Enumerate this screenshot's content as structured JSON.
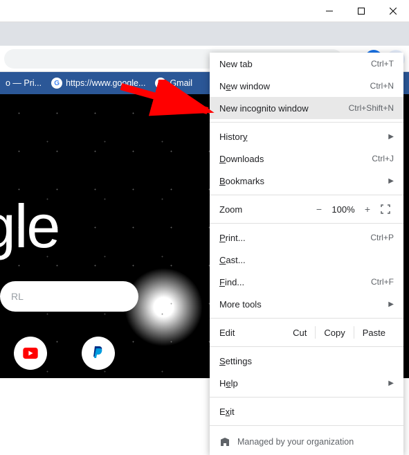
{
  "bookmarks": {
    "pri": "o — Pri...",
    "google": "https://www.google...",
    "gmail": "Gmail"
  },
  "content": {
    "logo": "oogle",
    "search_placeholder": "RL"
  },
  "menu": {
    "new_tab": {
      "label": "New tab",
      "shortcut": "Ctrl+T"
    },
    "new_window": {
      "label_pre": "N",
      "label_u": "e",
      "label_post": "w window",
      "shortcut": "Ctrl+N"
    },
    "new_incognito": {
      "label": "New incognito window",
      "shortcut": "Ctrl+Shift+N"
    },
    "history": {
      "label_pre": "Histor",
      "label_u": "y"
    },
    "downloads": {
      "label_u": "D",
      "label_post": "ownloads",
      "shortcut": "Ctrl+J"
    },
    "bookmarks": {
      "label_u": "B",
      "label_post": "ookmarks"
    },
    "zoom": {
      "label": "Zoom",
      "minus": "−",
      "value": "100%",
      "plus": "+"
    },
    "print": {
      "label_u": "P",
      "label_post": "rint...",
      "shortcut": "Ctrl+P"
    },
    "cast": {
      "label_u": "C",
      "label_post": "ast..."
    },
    "find": {
      "label_u": "F",
      "label_post": "ind...",
      "shortcut": "Ctrl+F"
    },
    "more_tools": {
      "label": "More tools"
    },
    "edit": {
      "label": "Edit",
      "cut": "Cut",
      "copy": "Copy",
      "paste": "Paste"
    },
    "settings": {
      "label_u": "S",
      "label_post": "ettings"
    },
    "help": {
      "label": "H",
      "label_u": "e",
      "label_post": "lp"
    },
    "exit": {
      "label_pre": "E",
      "label_u": "x",
      "label_post": "it"
    },
    "managed": "Managed by your organization"
  }
}
